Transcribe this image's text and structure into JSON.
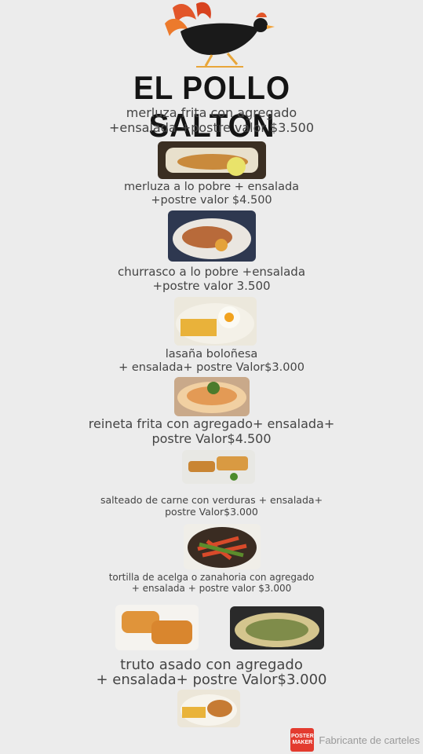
{
  "brand": "EL POLLO SALTON",
  "logo_icon": "rooster-logo-icon",
  "items": [
    {
      "line1": "merluza frita con agregado",
      "line2": "+ensalada +postre valor $3.500"
    },
    {
      "line1": "merluza a lo pobre + ensalada",
      "line2": "+postre valor $4.500"
    },
    {
      "line1": "churrasco a lo pobre +ensalada",
      "line2": "+postre valor 3.500"
    },
    {
      "line1": "lasaña boloñesa",
      "line2": "+ ensalada+ postre Valor$3.000"
    },
    {
      "line1": "reineta frita con agregado+ ensalada+",
      "line2": "postre Valor$4.500"
    },
    {
      "line1": "salteado de carne con verduras + ensalada+",
      "line2": "postre Valor$3.000"
    },
    {
      "line1": "tortilla de acelga o zanahoria con agregado",
      "line2": "+ ensalada + postre valor $3.000"
    },
    {
      "line1": "truto asado con agregado",
      "line2": "+ ensalada+ postre Valor$3.000"
    }
  ],
  "footer": {
    "badge": "POSTER MAKER",
    "text": "Fabricante de carteles"
  },
  "colors": {
    "background": "#ececec",
    "footer_badge": "#e33b2f"
  }
}
